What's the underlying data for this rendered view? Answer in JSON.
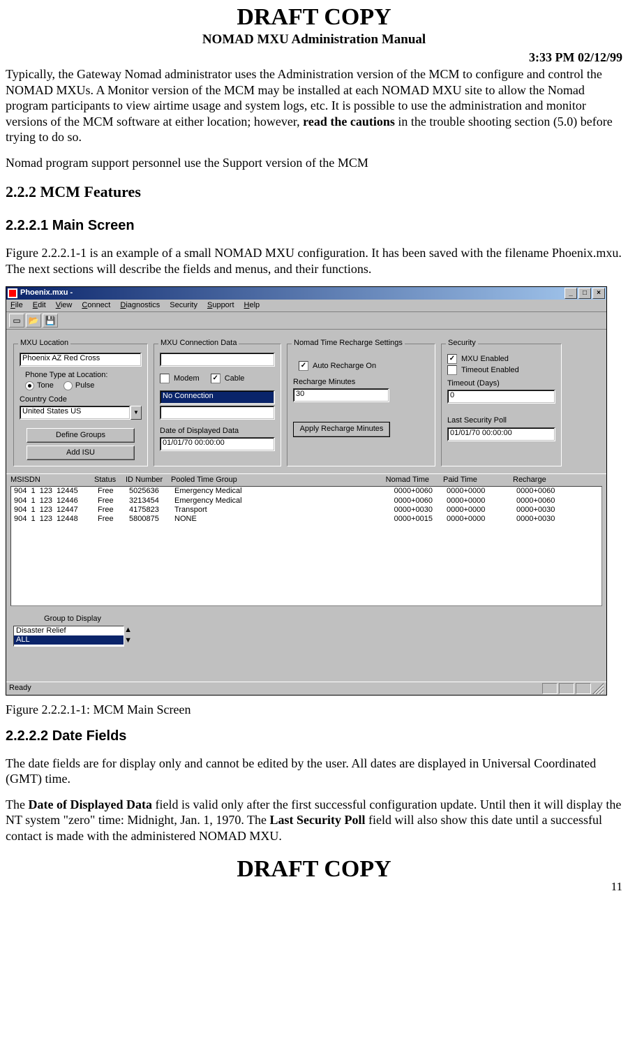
{
  "header": {
    "draft": "DRAFT COPY",
    "subtitle": "NOMAD MXU Administration Manual",
    "timestamp": "3:33 PM  02/12/99"
  },
  "paragraphs": {
    "p1a": "Typically, the Gateway Nomad administrator uses the Administration version of the MCM to configure and control the NOMAD MXUs.  A Monitor version of the MCM may be installed at each NOMAD MXU site to allow the Nomad program participants to view airtime usage and system logs, etc.  It is possible to use the administration and monitor versions of the MCM software at either location; however, ",
    "p1b": "read the cautions",
    "p1c": " in the trouble shooting section (5.0) before trying to do so.",
    "p2": " Nomad program support personnel use the Support version of the MCM",
    "h222": "2.2.2    MCM Features",
    "h2221": "2.2.2.1  Main Screen",
    "p3": "Figure 2.2.2.1-1 is an example of a small NOMAD MXU configuration.  It has been saved with the filename Phoenix.mxu.  The next sections will describe the fields and menus, and their functions.",
    "caption": "Figure 2.2.2.1-1:  MCM Main Screen",
    "h2222": "2.2.2.2  Date Fields",
    "p4": "The date fields are for display only and cannot be edited by the user.  All dates are displayed in Universal Coordinated  (GMT) time.",
    "p5a": "The ",
    "p5b": "Date of Displayed Data",
    "p5c": " field is valid only after the first successful configuration update.  Until then it will display the NT system \"zero\" time: Midnight, Jan. 1, 1970.    The ",
    "p5d": "Last Security Poll",
    "p5e": " field will also show this date until a successful contact is made with the administered NOMAD MXU."
  },
  "footer": {
    "draft": "DRAFT COPY",
    "page": "11"
  },
  "app": {
    "title": "Phoenix.mxu -",
    "menus": [
      "File",
      "Edit",
      "View",
      "Connect",
      "Diagnostics",
      "Security",
      "Support",
      "Help"
    ],
    "location": {
      "legend": "MXU Location",
      "name": "Phoenix AZ Red Cross",
      "phone_label": "Phone Type at Location:",
      "tone": "Tone",
      "pulse": "Pulse",
      "country_label": "Country Code",
      "country": "United States US",
      "define_groups": "Define Groups",
      "add_isu": "Add  ISU"
    },
    "conn": {
      "legend": "MXU Connection Data",
      "modem": "Modem",
      "cable": "Cable",
      "status": "No Connection",
      "date_label": "Date of Displayed Data",
      "date": "01/01/70 00:00:00"
    },
    "recharge": {
      "legend": "Nomad Time Recharge Settings",
      "auto": "Auto Recharge On",
      "minutes_label": "Recharge Minutes",
      "minutes": "30",
      "apply": "Apply Recharge Minutes"
    },
    "security": {
      "legend": "Security",
      "mxu_enabled": "MXU Enabled",
      "timeout_enabled": "Timeout Enabled",
      "timeout_days_label": "Timeout (Days)",
      "timeout_days": "0",
      "last_poll_label": "Last Security Poll",
      "last_poll": "01/01/70 00:00:00"
    },
    "table": {
      "headers": {
        "msisdn": "MSISDN",
        "status": "Status",
        "id": "ID Number",
        "ptg": "Pooled Time Group",
        "nt": "Nomad Time",
        "pt": "Paid Time",
        "rc": "Recharge"
      },
      "rows": [
        {
          "msisdn": "904  1  123  12445",
          "status": "Free",
          "id": "5025636",
          "ptg": "Emergency Medical",
          "nt": "0000+0060",
          "pt": "0000+0000",
          "rc": "0000+0060"
        },
        {
          "msisdn": "904  1  123  12446",
          "status": "Free",
          "id": "3213454",
          "ptg": "Emergency Medical",
          "nt": "0000+0060",
          "pt": "0000+0000",
          "rc": "0000+0060"
        },
        {
          "msisdn": "904  1  123  12447",
          "status": "Free",
          "id": "4175823",
          "ptg": "Transport",
          "nt": "0000+0030",
          "pt": "0000+0000",
          "rc": "0000+0030"
        },
        {
          "msisdn": "904  1  123  12448",
          "status": "Free",
          "id": "5800875",
          "ptg": "NONE",
          "nt": "0000+0015",
          "pt": "0000+0000",
          "rc": "0000+0030"
        }
      ]
    },
    "group_display": {
      "label": "Group to Display",
      "opts": [
        "Disaster Relief",
        "ALL"
      ]
    },
    "statusbar": "Ready"
  }
}
